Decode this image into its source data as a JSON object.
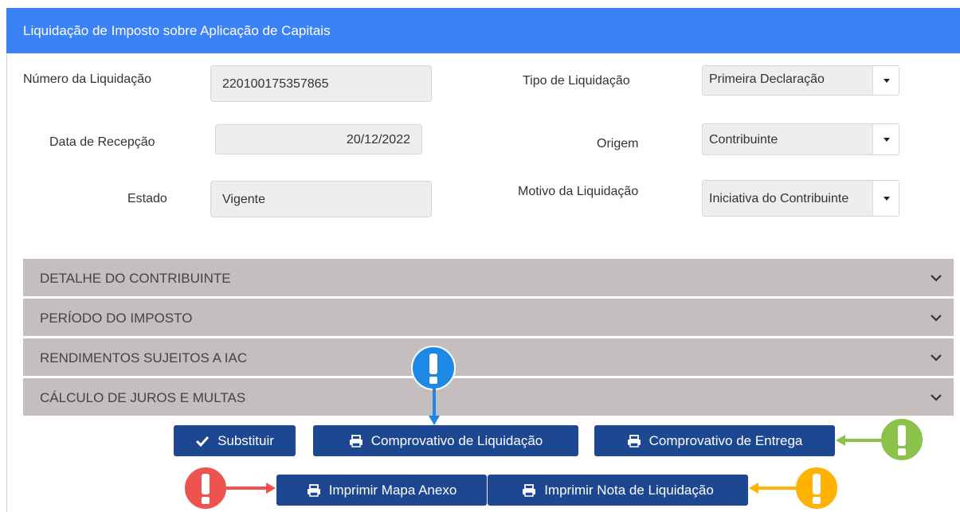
{
  "header": {
    "title": "Liquidação de Imposto sobre Aplicação de Capitais"
  },
  "form": {
    "numero_label": "Número da Liquidação",
    "numero_value": "220100175357865",
    "data_label": "Data de Recepção",
    "data_value": "20/12/2022",
    "estado_label": "Estado",
    "estado_value": "Vigente",
    "tipo_label": "Tipo de Liquidação",
    "tipo_value": "Primeira Declaração",
    "origem_label": "Origem",
    "origem_value": "Contribuinte",
    "motivo_label": "Motivo da Liquidação",
    "motivo_value": "Iniciativa do Contribuinte"
  },
  "panels": [
    {
      "label": "DETALHE DO CONTRIBUINTE"
    },
    {
      "label": "PERÍODO DO IMPOSTO"
    },
    {
      "label": "RENDIMENTOS SUJEITOS A IAC"
    },
    {
      "label": "CÁLCULO DE JUROS E MULTAS"
    }
  ],
  "buttons": {
    "substituir": "Substituir",
    "comprovativo_liquidacao": "Comprovativo de Liquidação",
    "comprovativo_entrega": "Comprovativo de Entrega",
    "imprimir_mapa": "Imprimir Mapa Anexo",
    "imprimir_nota": "Imprimir Nota de Liquidação"
  },
  "colors": {
    "header": "#3b82f6",
    "button": "#1d4791",
    "panel": "#c4bebe",
    "marker_blue": "#1e88e5",
    "marker_green": "#8bc34a",
    "marker_red": "#ef5350",
    "marker_yellow": "#ffb300"
  },
  "icons": [
    "check-icon",
    "printer-icon",
    "chevron-down-icon",
    "exclamation-marker-icon"
  ]
}
